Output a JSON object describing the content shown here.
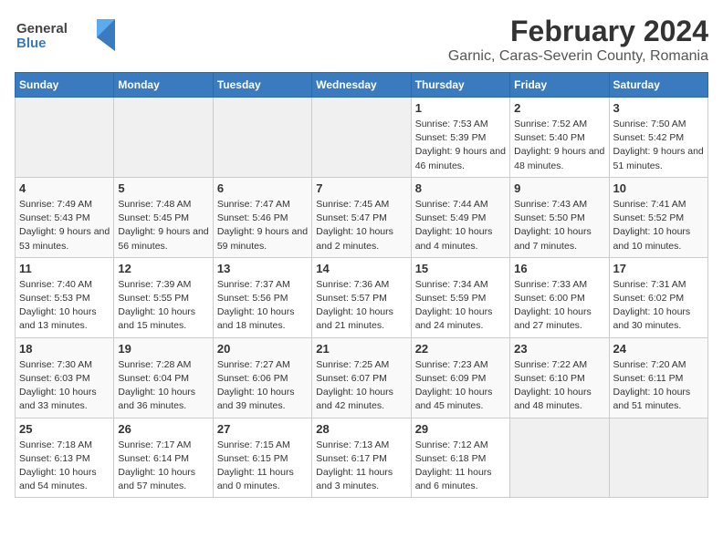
{
  "logo": {
    "general": "General",
    "blue": "Blue"
  },
  "title": "February 2024",
  "subtitle": "Garnic, Caras-Severin County, Romania",
  "days_of_week": [
    "Sunday",
    "Monday",
    "Tuesday",
    "Wednesday",
    "Thursday",
    "Friday",
    "Saturday"
  ],
  "weeks": [
    [
      {
        "day": "",
        "info": ""
      },
      {
        "day": "",
        "info": ""
      },
      {
        "day": "",
        "info": ""
      },
      {
        "day": "",
        "info": ""
      },
      {
        "day": "1",
        "info": "Sunrise: 7:53 AM\nSunset: 5:39 PM\nDaylight: 9 hours and 46 minutes."
      },
      {
        "day": "2",
        "info": "Sunrise: 7:52 AM\nSunset: 5:40 PM\nDaylight: 9 hours and 48 minutes."
      },
      {
        "day": "3",
        "info": "Sunrise: 7:50 AM\nSunset: 5:42 PM\nDaylight: 9 hours and 51 minutes."
      }
    ],
    [
      {
        "day": "4",
        "info": "Sunrise: 7:49 AM\nSunset: 5:43 PM\nDaylight: 9 hours and 53 minutes."
      },
      {
        "day": "5",
        "info": "Sunrise: 7:48 AM\nSunset: 5:45 PM\nDaylight: 9 hours and 56 minutes."
      },
      {
        "day": "6",
        "info": "Sunrise: 7:47 AM\nSunset: 5:46 PM\nDaylight: 9 hours and 59 minutes."
      },
      {
        "day": "7",
        "info": "Sunrise: 7:45 AM\nSunset: 5:47 PM\nDaylight: 10 hours and 2 minutes."
      },
      {
        "day": "8",
        "info": "Sunrise: 7:44 AM\nSunset: 5:49 PM\nDaylight: 10 hours and 4 minutes."
      },
      {
        "day": "9",
        "info": "Sunrise: 7:43 AM\nSunset: 5:50 PM\nDaylight: 10 hours and 7 minutes."
      },
      {
        "day": "10",
        "info": "Sunrise: 7:41 AM\nSunset: 5:52 PM\nDaylight: 10 hours and 10 minutes."
      }
    ],
    [
      {
        "day": "11",
        "info": "Sunrise: 7:40 AM\nSunset: 5:53 PM\nDaylight: 10 hours and 13 minutes."
      },
      {
        "day": "12",
        "info": "Sunrise: 7:39 AM\nSunset: 5:55 PM\nDaylight: 10 hours and 15 minutes."
      },
      {
        "day": "13",
        "info": "Sunrise: 7:37 AM\nSunset: 5:56 PM\nDaylight: 10 hours and 18 minutes."
      },
      {
        "day": "14",
        "info": "Sunrise: 7:36 AM\nSunset: 5:57 PM\nDaylight: 10 hours and 21 minutes."
      },
      {
        "day": "15",
        "info": "Sunrise: 7:34 AM\nSunset: 5:59 PM\nDaylight: 10 hours and 24 minutes."
      },
      {
        "day": "16",
        "info": "Sunrise: 7:33 AM\nSunset: 6:00 PM\nDaylight: 10 hours and 27 minutes."
      },
      {
        "day": "17",
        "info": "Sunrise: 7:31 AM\nSunset: 6:02 PM\nDaylight: 10 hours and 30 minutes."
      }
    ],
    [
      {
        "day": "18",
        "info": "Sunrise: 7:30 AM\nSunset: 6:03 PM\nDaylight: 10 hours and 33 minutes."
      },
      {
        "day": "19",
        "info": "Sunrise: 7:28 AM\nSunset: 6:04 PM\nDaylight: 10 hours and 36 minutes."
      },
      {
        "day": "20",
        "info": "Sunrise: 7:27 AM\nSunset: 6:06 PM\nDaylight: 10 hours and 39 minutes."
      },
      {
        "day": "21",
        "info": "Sunrise: 7:25 AM\nSunset: 6:07 PM\nDaylight: 10 hours and 42 minutes."
      },
      {
        "day": "22",
        "info": "Sunrise: 7:23 AM\nSunset: 6:09 PM\nDaylight: 10 hours and 45 minutes."
      },
      {
        "day": "23",
        "info": "Sunrise: 7:22 AM\nSunset: 6:10 PM\nDaylight: 10 hours and 48 minutes."
      },
      {
        "day": "24",
        "info": "Sunrise: 7:20 AM\nSunset: 6:11 PM\nDaylight: 10 hours and 51 minutes."
      }
    ],
    [
      {
        "day": "25",
        "info": "Sunrise: 7:18 AM\nSunset: 6:13 PM\nDaylight: 10 hours and 54 minutes."
      },
      {
        "day": "26",
        "info": "Sunrise: 7:17 AM\nSunset: 6:14 PM\nDaylight: 10 hours and 57 minutes."
      },
      {
        "day": "27",
        "info": "Sunrise: 7:15 AM\nSunset: 6:15 PM\nDaylight: 11 hours and 0 minutes."
      },
      {
        "day": "28",
        "info": "Sunrise: 7:13 AM\nSunset: 6:17 PM\nDaylight: 11 hours and 3 minutes."
      },
      {
        "day": "29",
        "info": "Sunrise: 7:12 AM\nSunset: 6:18 PM\nDaylight: 11 hours and 6 minutes."
      },
      {
        "day": "",
        "info": ""
      },
      {
        "day": "",
        "info": ""
      }
    ]
  ]
}
